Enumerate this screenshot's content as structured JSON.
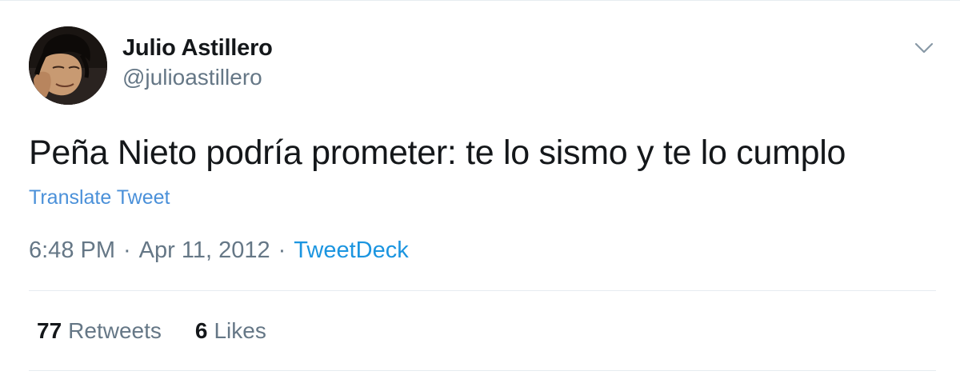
{
  "author": {
    "display_name": "Julio Astillero",
    "handle": "@julioastillero"
  },
  "tweet": {
    "text": "Peña Nieto podría prometer: te lo sismo y te lo cumplo",
    "translate_label": "Translate Tweet"
  },
  "meta": {
    "time": "6:48 PM",
    "separator": "·",
    "date": "Apr 11, 2012",
    "source": "TweetDeck"
  },
  "stats": {
    "retweets_count": "77",
    "retweets_label": "Retweets",
    "likes_count": "6",
    "likes_label": "Likes"
  },
  "icons": {
    "menu": "chevron-down-icon"
  },
  "colors": {
    "link": "#1b95e0",
    "secondary_text": "#657786",
    "primary_text": "#14171a",
    "divider": "#e6ecf0"
  }
}
